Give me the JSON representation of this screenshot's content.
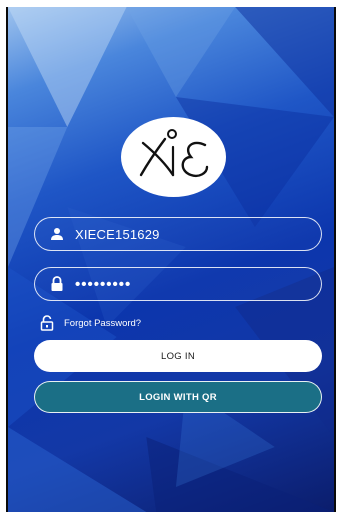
{
  "login": {
    "username_value": "XIECE151629",
    "password_masked": "•••••••••",
    "forgot_label": "Forgot Password?",
    "login_button_label": "LOG IN",
    "qr_button_label": "LOGIN WITH QR"
  },
  "icons": {
    "logo": "xie-logo",
    "username": "person-icon",
    "password": "lock-icon",
    "forgot": "unlock-icon"
  },
  "colors": {
    "background_top": "#4a86dc",
    "background_bottom": "#0b1d6c",
    "qr_button": "#1b6f86",
    "login_button": "#ffffff"
  }
}
